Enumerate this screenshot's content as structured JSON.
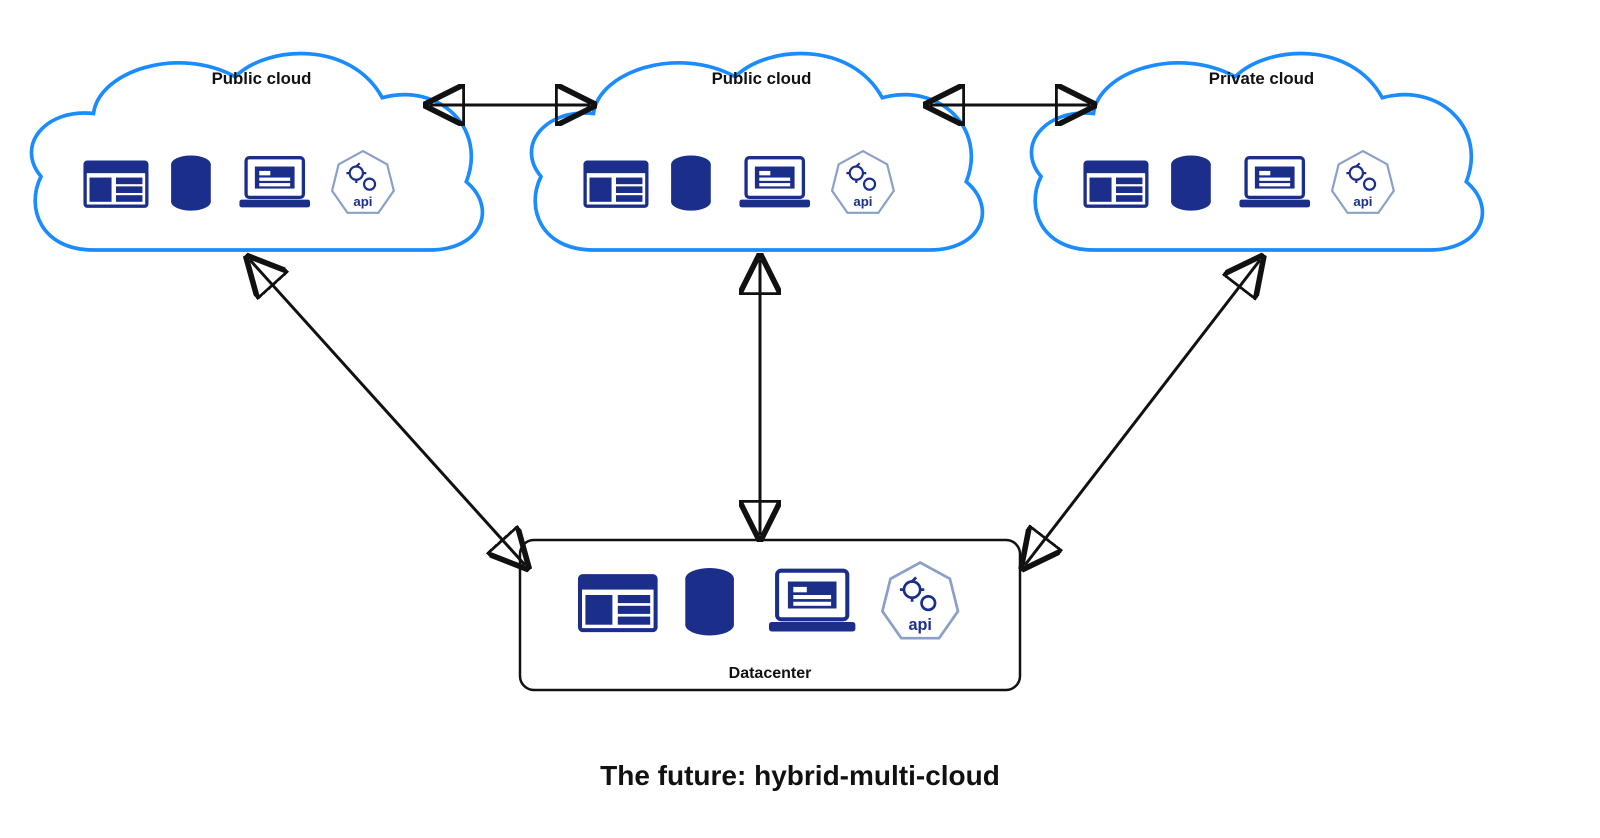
{
  "clouds": [
    {
      "label": "Public cloud"
    },
    {
      "label": "Public cloud"
    },
    {
      "label": "Private cloud"
    }
  ],
  "datacenter": {
    "label": "Datacenter"
  },
  "icons": {
    "web": "web-icon",
    "db": "database-icon",
    "app": "laptop-icon",
    "api": "api-icon",
    "api_text": "api"
  },
  "caption": "The future: hybrid-multi-cloud",
  "colors": {
    "cloud_stroke": "#1a8cff",
    "icon_fill": "#1b2f8a",
    "arrow": "#111111",
    "heptagon_fill": "#ffffff",
    "heptagon_stroke": "#8aa0c8"
  }
}
